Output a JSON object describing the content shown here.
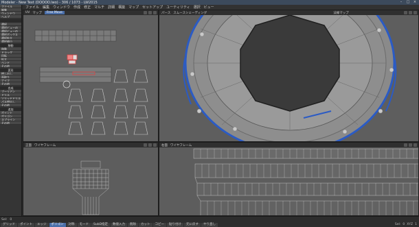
{
  "app": {
    "title": "Modeler - New Text (DOOOO.lwo) - 306 / 1073 - LW2015"
  },
  "window_controls": [
    "–",
    "□",
    "×"
  ],
  "menubar": [
    "ファイル",
    "編集",
    "ウィンドウ",
    "作成",
    "修正",
    "マルチ",
    "詳細",
    "構築",
    "マップ",
    "セットアップ",
    "ユーティリティ",
    "選択",
    "ビュー"
  ],
  "sidebar": {
    "group1": {
      "items": [
        "ファイル",
        "編集",
        "ウィンドウ",
        "ヘルプ"
      ]
    },
    "group2": {
      "items": [
        "選択",
        "選択ビューの",
        "選択ビューの",
        "選択ボックス",
        "選択拡大",
        "選択縮小"
      ]
    },
    "group3": {
      "head": "移動",
      "items": [
        "移動",
        "ドラッグ",
        "回転",
        "拡大",
        "ベンド",
        "その他"
      ]
    },
    "group4": {
      "head": "変形",
      "items": [
        "押し出し",
        "面取り",
        "ナイフ",
        "その他"
      ]
    },
    "group5": {
      "head": "合成",
      "items": [
        "ブーリアン",
        "ドリル",
        "ソリッドドリル",
        "パス押出し",
        "その他"
      ]
    },
    "group6": {
      "head": "追加",
      "items": [
        "ポイント",
        "ポリゴン",
        "スプライン",
        "その他"
      ]
    }
  },
  "viewports": {
    "top_left": {
      "label": "UV",
      "layer": "マップ",
      "mode": "Free Move"
    },
    "top_right": {
      "label": "パース",
      "mode": "スムースシェーディング",
      "mode2": "法線マップ"
    },
    "bottom_left": {
      "label": "正面",
      "mode": "ワイヤフレーム"
    },
    "bottom_right": {
      "label": "右面",
      "mode": "ワイヤフレーム"
    }
  },
  "statusbar": {
    "row1": [
      "Sel:",
      "0"
    ],
    "buttons": [
      "グリッド",
      "ポイント",
      "エッジ",
      "ポリゴン",
      "対称",
      "モード",
      "SubD指定",
      "数値入力",
      "削除",
      "カット",
      "コピー",
      "貼り付け",
      "元に戻す",
      "やり直し"
    ],
    "active_button": "ポリゴン",
    "right": [
      "Sel:",
      "0",
      "XYZ",
      "1"
    ]
  }
}
